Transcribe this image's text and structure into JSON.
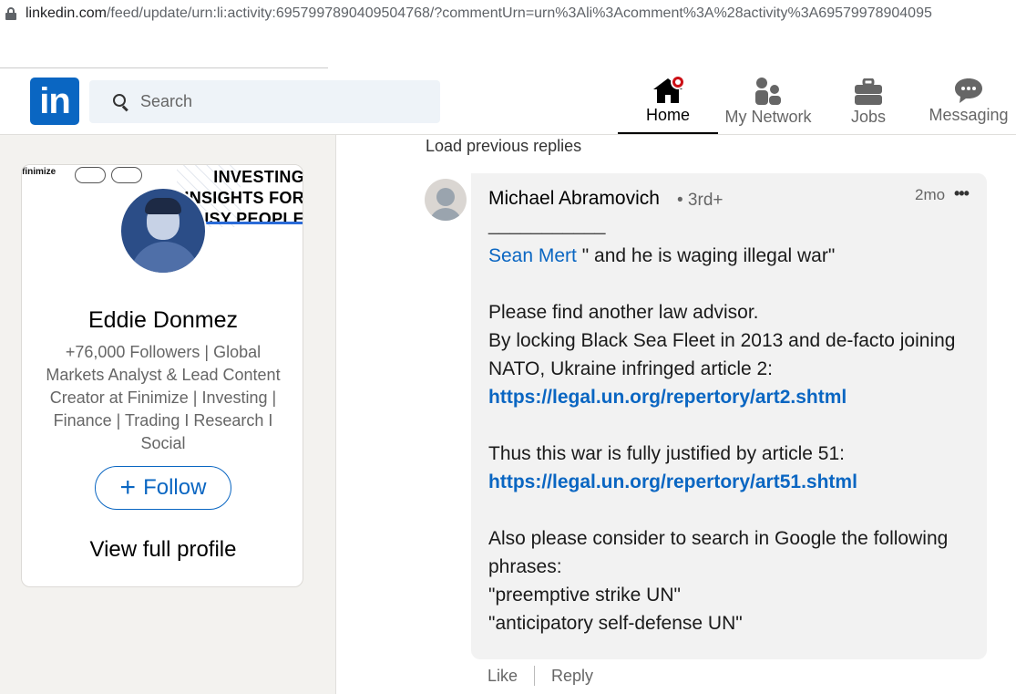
{
  "browser": {
    "url_host": "linkedin.com",
    "url_path": "/feed/update/urn:li:activity:6957997890409504768/?commentUrn=urn%3Ali%3Acomment%3A%28activity%3A69579978904095"
  },
  "nav": {
    "logo": "in",
    "search_placeholder": "Search",
    "items": [
      {
        "label": "Home",
        "icon": "home-icon",
        "active": true
      },
      {
        "label": "My Network",
        "icon": "network-icon"
      },
      {
        "label": "Jobs",
        "icon": "briefcase-icon"
      },
      {
        "label": "Messaging",
        "icon": "messaging-icon"
      }
    ]
  },
  "profile": {
    "banner_brand": "finimize",
    "banner_lines": [
      "INVESTING",
      "INSIGHTS FOR",
      "BUSY PEOPLE"
    ],
    "name": "Eddie Donmez",
    "headline": "+76,000 Followers | Global Markets Analyst & Lead Content Creator at Finimize | Investing | Finance | Trading I Research I Social",
    "follow_label": "Follow",
    "view_profile_label": "View full profile"
  },
  "thread": {
    "load_previous": "Load previous replies",
    "comment": {
      "author": "Michael Abramovich",
      "degree": "• 3rd+",
      "time": "2mo",
      "more": "•••",
      "separator": "___________",
      "mention": "Sean Mert",
      "line1_rest": " \" and he is waging illegal war\"",
      "p2_l1": "Please find another law advisor.",
      "p2_l2": "By locking Black Sea Fleet in 2013 and de-facto joining NATO, Ukraine infringed article 2:",
      "link1": "https://legal.un.org/repertory/art2.shtml",
      "p3": "Thus this war is fully justified by article 51:",
      "link2": "https://legal.un.org/repertory/art51.shtml",
      "p4_l1": "Also please consider to search in Google the following phrases:",
      "p4_l2": "\"preemptive strike UN\"",
      "p4_l3": "\"anticipatory self-defense UN\""
    },
    "actions": {
      "like": "Like",
      "reply": "Reply"
    }
  },
  "colors": {
    "brand": "#0a66c2",
    "notification": "#cc1016"
  }
}
